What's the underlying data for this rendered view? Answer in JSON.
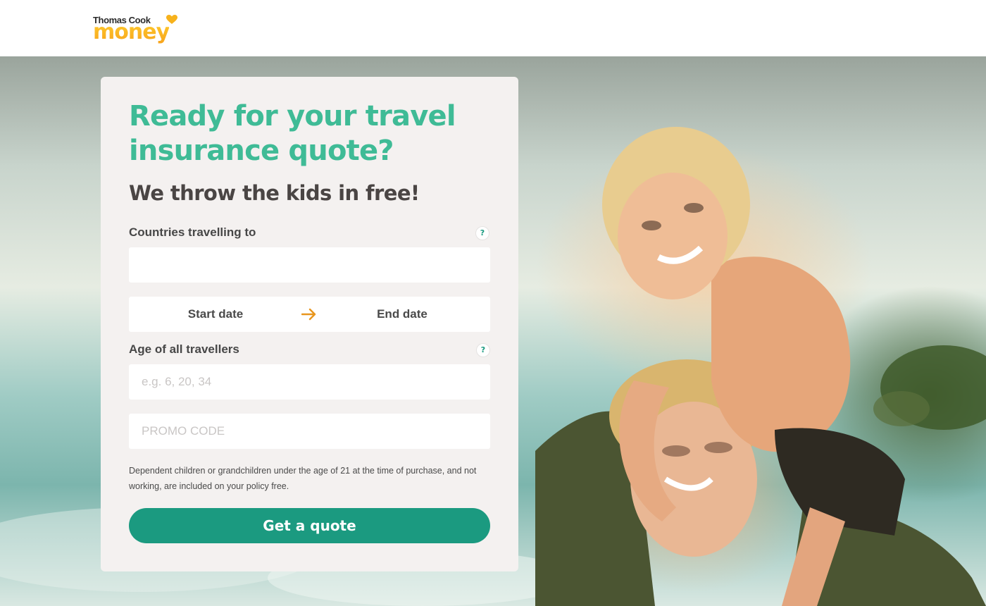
{
  "header": {
    "logo": {
      "line1": "Thomas Cook",
      "line2": "money",
      "heart_color": "#f7b21c"
    }
  },
  "form": {
    "title": "Ready for your travel insurance quote?",
    "subtitle": "We throw the kids in free!",
    "countries": {
      "label": "Countries travelling to",
      "help": "?",
      "value": ""
    },
    "dates": {
      "start": "Start date",
      "end": "End date",
      "arrow_icon": "arrow-right-icon"
    },
    "ages": {
      "label": "Age of all travellers",
      "help": "?",
      "placeholder": "e.g. 6, 20, 34",
      "value": ""
    },
    "promo": {
      "placeholder": "PROMO CODE",
      "value": ""
    },
    "note": "Dependent children or grandchildren under the age of 21 at the time of purchase, and not working, are included on your policy free.",
    "submit": "Get a quote"
  },
  "colors": {
    "title": "#3fbb96",
    "button": "#1b9a80",
    "card": "#f4f1f0",
    "arrow": "#e8961e",
    "logo_gradient": [
      "#ffcf2e",
      "#f7a21c"
    ]
  }
}
